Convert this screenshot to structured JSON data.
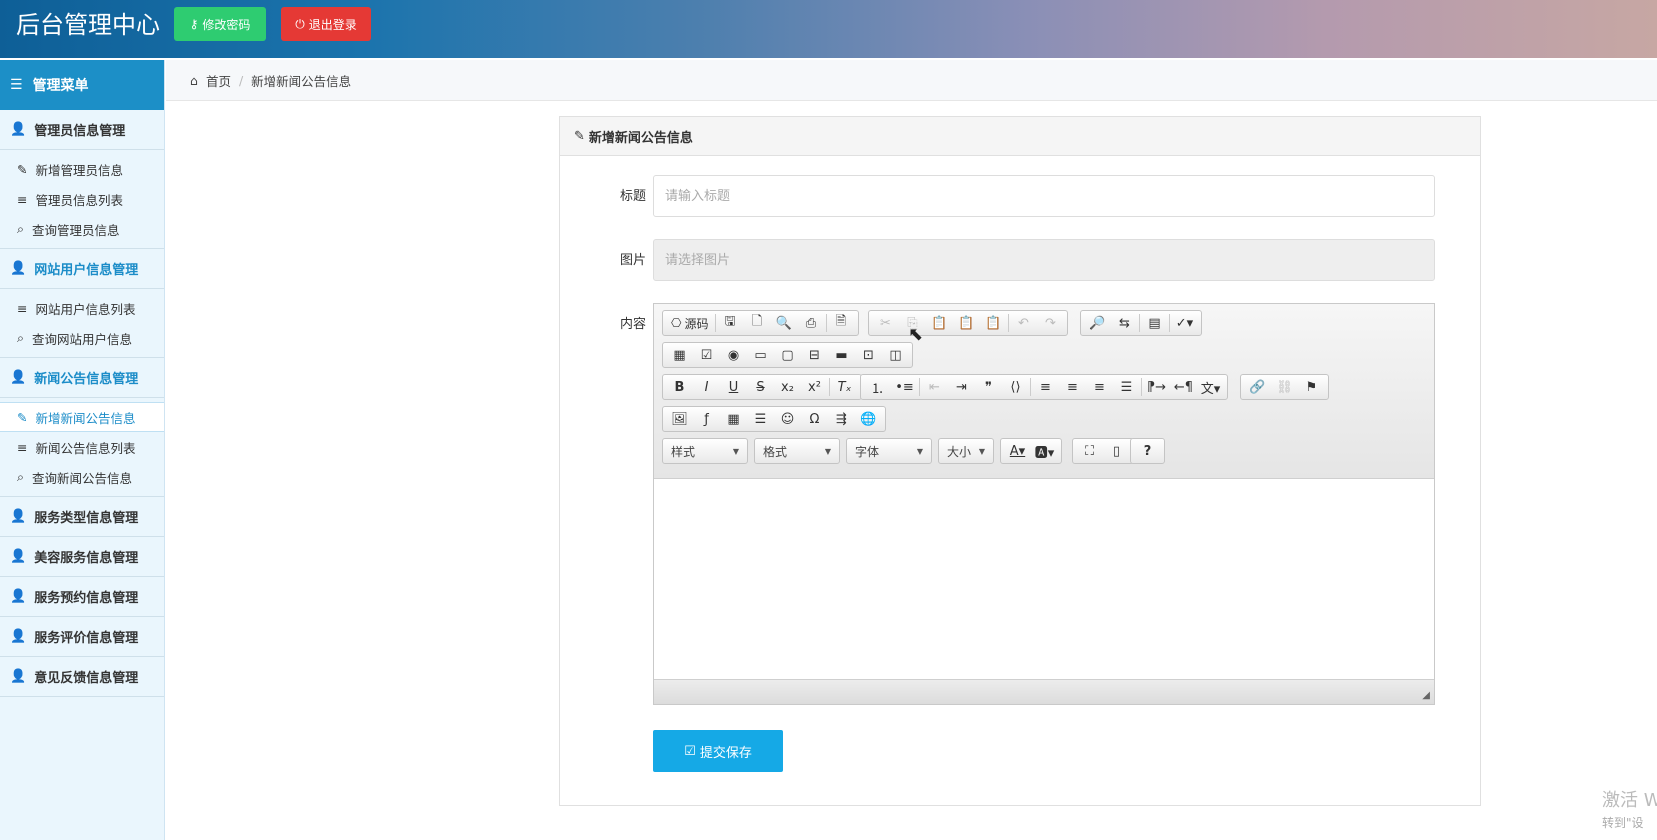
{
  "header": {
    "title": "后台管理中心",
    "change_password": "修改密码",
    "logout": "退出登录"
  },
  "sidebar": {
    "title": "管理菜单",
    "groups": [
      {
        "label": "管理员信息管理",
        "items": [
          "新增管理员信息",
          "管理员信息列表",
          "查询管理员信息"
        ]
      },
      {
        "label": "网站用户信息管理",
        "items": [
          "网站用户信息列表",
          "查询网站用户信息"
        ]
      },
      {
        "label": "新闻公告信息管理",
        "items": [
          "新增新闻公告信息",
          "新闻公告信息列表",
          "查询新闻公告信息"
        ]
      },
      {
        "label": "服务类型信息管理"
      },
      {
        "label": "美容服务信息管理"
      },
      {
        "label": "服务预约信息管理"
      },
      {
        "label": "服务评价信息管理"
      },
      {
        "label": "意见反馈信息管理"
      }
    ]
  },
  "breadcrumb": {
    "home": "首页",
    "current": "新增新闻公告信息"
  },
  "form": {
    "heading": "新增新闻公告信息",
    "title_label": "标题",
    "title_placeholder": "请输入标题",
    "image_label": "图片",
    "image_placeholder": "请选择图片",
    "content_label": "内容",
    "submit": "提交保存"
  },
  "editor": {
    "source_label": "源码",
    "styles": "样式",
    "format": "格式",
    "font": "字体",
    "size": "大小"
  },
  "watermark": {
    "line1": "激活 W",
    "line2": "转到\"设"
  }
}
